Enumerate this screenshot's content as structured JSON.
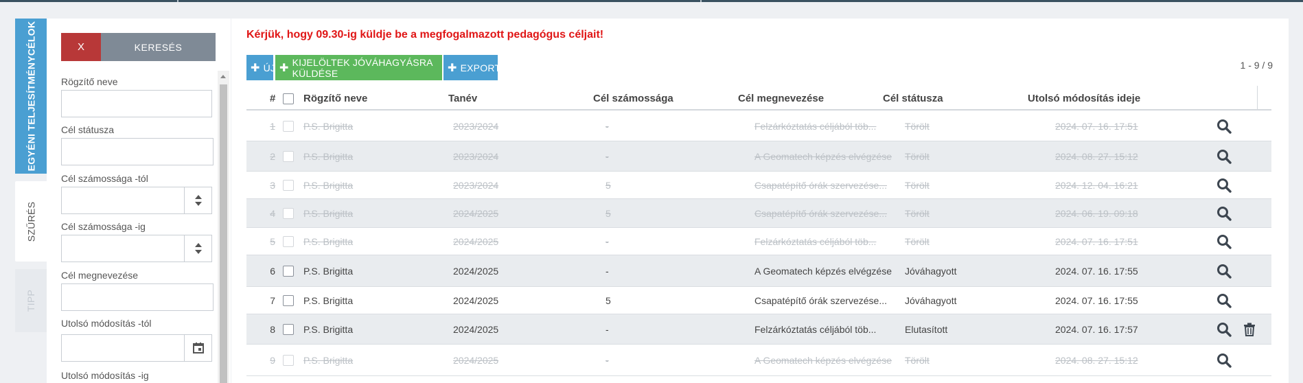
{
  "sidebar_tabs": [
    {
      "label": "EGYÉNI TELJESÍTMÉNYCÉLOK"
    },
    {
      "label": "SZŰRÉS"
    },
    {
      "label": "TIPP"
    }
  ],
  "filter": {
    "clear_label": "X",
    "search_label": "KERESÉS",
    "fields": [
      {
        "label": "Rögzítő neve",
        "value": ""
      },
      {
        "label": "Cél státusza",
        "value": ""
      },
      {
        "label": "Cél számossága -tól",
        "value": ""
      },
      {
        "label": "Cél számossága -ig",
        "value": ""
      },
      {
        "label": "Cél megnevezése",
        "value": ""
      },
      {
        "label": "Utolsó módosítás -tól",
        "value": ""
      },
      {
        "label": "Utolsó módosítás -ig",
        "value": ""
      }
    ]
  },
  "notice": "Kérjük, hogy 09.30-ig küldje be a megfogalmazott pedagógus céljait!",
  "toolbar": {
    "new_label": "ÚJ",
    "send_label": "KIJELÖLTEK JÓVÁHAGYÁSRA KÜLDÉSE",
    "export_label": "EXPORT"
  },
  "pager": "1 - 9 / 9",
  "table": {
    "headers": {
      "num": "#",
      "recorder": "Rögzítő neve",
      "year": "Tanév",
      "count": "Cél számossága",
      "name": "Cél megnevezése",
      "status": "Cél státusza",
      "modified": "Utolsó módosítás ideje"
    },
    "rows": [
      {
        "num": "1",
        "recorder": "P.S. Brigitta",
        "year": "2023/2024",
        "count": "-",
        "name": "Felzárkóztatás céljából töb...",
        "status": "Törölt",
        "modified": "2024. 07. 16. 17:51",
        "deleted": true
      },
      {
        "num": "2",
        "recorder": "P.S. Brigitta",
        "year": "2023/2024",
        "count": "-",
        "name": "A Geomatech képzés elvégzése",
        "status": "Törölt",
        "modified": "2024. 08. 27. 15:12",
        "deleted": true
      },
      {
        "num": "3",
        "recorder": "P.S. Brigitta",
        "year": "2023/2024",
        "count": "5",
        "name": "Csapatépítő órák szervezése...",
        "status": "Törölt",
        "modified": "2024. 12. 04. 16:21",
        "deleted": true
      },
      {
        "num": "4",
        "recorder": "P.S. Brigitta",
        "year": "2024/2025",
        "count": "5",
        "name": "Csapatépítő órák szervezése...",
        "status": "Törölt",
        "modified": "2024. 06. 19. 09:18",
        "deleted": true
      },
      {
        "num": "5",
        "recorder": "P.S. Brigitta",
        "year": "2024/2025",
        "count": "-",
        "name": "Felzárkóztatás céljából töb...",
        "status": "Törölt",
        "modified": "2024. 07. 16. 17:51",
        "deleted": true
      },
      {
        "num": "6",
        "recorder": "P.S. Brigitta",
        "year": "2024/2025",
        "count": "-",
        "name": "A Geomatech képzés elvégzése",
        "status": "Jóváhagyott",
        "modified": "2024. 07. 16. 17:55",
        "deleted": false
      },
      {
        "num": "7",
        "recorder": "P.S. Brigitta",
        "year": "2024/2025",
        "count": "5",
        "name": "Csapatépítő órák szervezése...",
        "status": "Jóváhagyott",
        "modified": "2024. 07. 16. 17:55",
        "deleted": false
      },
      {
        "num": "8",
        "recorder": "P.S. Brigitta",
        "year": "2024/2025",
        "count": "-",
        "name": "Felzárkóztatás céljából töb...",
        "status": "Elutasított",
        "modified": "2024. 07. 16. 17:57",
        "deleted": false,
        "deletable": true
      },
      {
        "num": "9",
        "recorder": "P.S. Brigitta",
        "year": "2024/2025",
        "count": "-",
        "name": "A Geomatech képzés elvégzése",
        "status": "Törölt",
        "modified": "2024. 08. 27. 15:12",
        "deleted": true
      }
    ]
  },
  "colors": {
    "accent_blue": "#4a9fd2",
    "send_green": "#5cb85c",
    "clear_red": "#b83838",
    "notice_red": "#e01515"
  }
}
